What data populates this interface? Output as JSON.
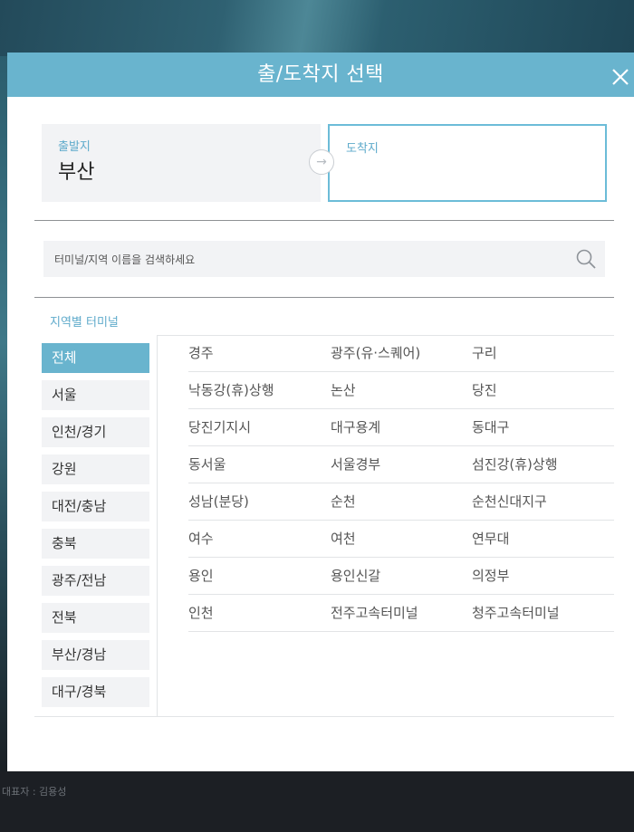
{
  "modal": {
    "title": "출/도착지 선택"
  },
  "origin": {
    "label": "출발지",
    "value": "부산"
  },
  "destination": {
    "label": "도착지",
    "value": ""
  },
  "search": {
    "placeholder": "터미널/지역 이름을 검색하세요"
  },
  "section_title": "지역별 터미널",
  "regions": [
    {
      "label": "전체",
      "selected": true
    },
    {
      "label": "서울"
    },
    {
      "label": "인천/경기"
    },
    {
      "label": "강원"
    },
    {
      "label": "대전/충남"
    },
    {
      "label": "충북"
    },
    {
      "label": "광주/전남"
    },
    {
      "label": "전북"
    },
    {
      "label": "부산/경남"
    },
    {
      "label": "대구/경북"
    }
  ],
  "terminals": [
    "경주",
    "광주(유·스퀘어)",
    "구리",
    "낙동강(휴)상행",
    "논산",
    "당진",
    "당진기지시",
    "대구용계",
    "동대구",
    "동서울",
    "서울경부",
    "섬진강(휴)상행",
    "성남(분당)",
    "순천",
    "순천신대지구",
    "여수",
    "여천",
    "연무대",
    "용인",
    "용인신갈",
    "의정부",
    "인천",
    "전주고속터미널",
    "청주고속터미널"
  ],
  "footer": {
    "ceo": "대표자 : 김용성"
  },
  "colors": {
    "accent": "#69b4ce",
    "label": "#5eaacb"
  },
  "icons": {
    "close": "close-icon",
    "search": "search-icon",
    "arrow": "arrow-right-icon"
  }
}
